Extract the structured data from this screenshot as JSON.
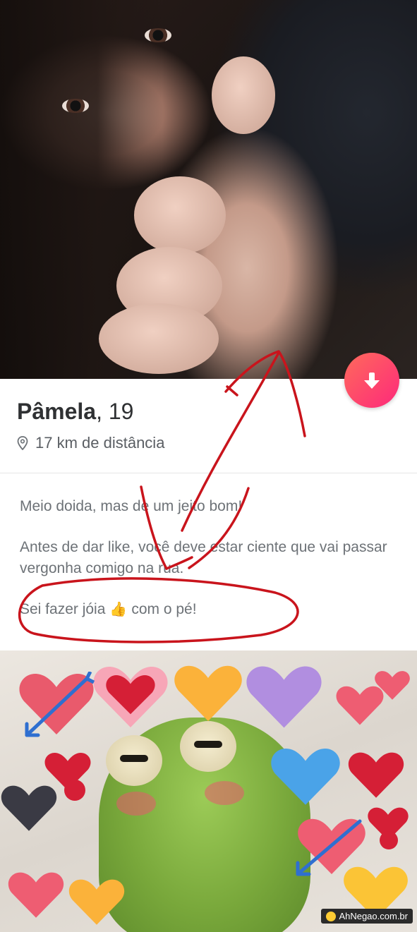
{
  "profile": {
    "name": "Pâmela",
    "age_text": ", 19",
    "distance": "17 km de distância",
    "bio": {
      "line1": "Meio doida, mas de um jeito bom!",
      "line2": "Antes de dar like, você deve estar ciente que vai passar vergonha comigo na rua.",
      "line3_before": "Sei fazer  jóia",
      "line3_emoji": "👍",
      "line3_after": "com o pé!"
    }
  },
  "actions": {
    "collapse_icon": "arrow-down-icon"
  },
  "colors": {
    "accent_start": "#ff6a5b",
    "accent_end": "#fd297b",
    "scribble": "#c9141c"
  },
  "watermark": "AhNegao.com.br"
}
